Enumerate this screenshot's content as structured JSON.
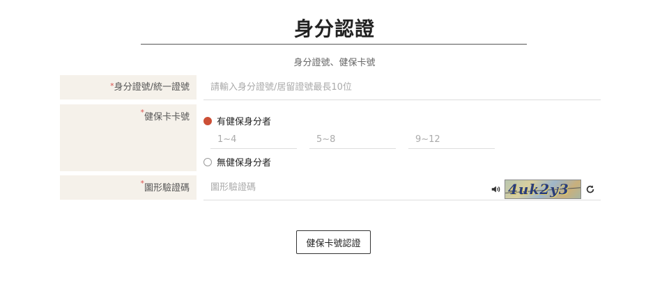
{
  "page": {
    "title": "身分認證",
    "subtitle": "身分證號、健保卡號"
  },
  "form": {
    "id_field": {
      "required_mark": "*",
      "label": "身分證號/統一證號",
      "placeholder": "請輸入身分證號/居留證號最長10位",
      "value": ""
    },
    "nhi_field": {
      "required_mark": "*",
      "label": "健保卡卡號",
      "options": [
        {
          "label": "有健保身分者",
          "selected": true
        },
        {
          "label": "無健保身分者",
          "selected": false
        }
      ],
      "segments": [
        {
          "placeholder": "1~4",
          "value": ""
        },
        {
          "placeholder": "5~8",
          "value": ""
        },
        {
          "placeholder": "9~12",
          "value": ""
        }
      ]
    },
    "captcha_field": {
      "required_mark": "*",
      "label": "圖形驗證碼",
      "placeholder": "圖形驗證碼",
      "value": "",
      "captcha_text": "4uk2y3"
    },
    "submit_label": "健保卡號認證"
  },
  "colors": {
    "label_bg": "#f5f1ea",
    "required": "#d9534f",
    "radio_selected": "#cc4f36"
  }
}
